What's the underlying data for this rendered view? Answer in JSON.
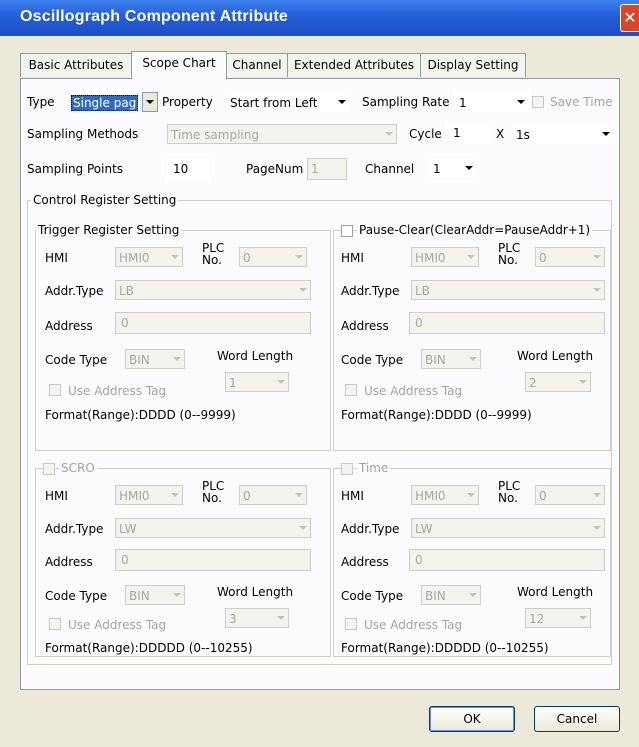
{
  "window": {
    "title": "Oscillograph Component Attribute",
    "close_glyph": "✕"
  },
  "tabs": [
    "Basic Attributes",
    "Scope Chart",
    "Channel",
    "Extended Attributes",
    "Display Setting"
  ],
  "scope": {
    "type_label": "Type",
    "type_value": "Single pag",
    "property_label": "Property",
    "property_value": "Start from Left",
    "sampling_rate_label": "Sampling Rate",
    "sampling_rate_value": "1",
    "save_time_label": "Save Time",
    "sampling_methods_label": "Sampling Methods",
    "sampling_methods_value": "Time sampling",
    "cycle_label": "Cycle",
    "cycle_value": "1",
    "x_label": "X",
    "cycle_unit": "1s",
    "sampling_points_label": "Sampling Points",
    "sampling_points_value": "10",
    "pagenum_label": "PageNum",
    "pagenum_value": "1",
    "channel_label": "Channel",
    "channel_value": "1"
  },
  "control": {
    "title": "Control Register Setting",
    "trigger": {
      "title": "Trigger Register Setting",
      "hmi_label": "HMI",
      "hmi_value": "HMI0",
      "plc_label1": "PLC",
      "plc_label2": "No.",
      "plc_value": "0",
      "addr_type_label": "Addr.Type",
      "addr_type_value": "LB",
      "address_label": "Address",
      "address_value": "0",
      "code_type_label": "Code Type",
      "code_type_value": "BIN",
      "word_length_label": "Word Length",
      "word_length_value": "1",
      "use_tag_label": "Use Address Tag",
      "format": "Format(Range):DDDD (0--9999)"
    },
    "pause": {
      "title": "Pause-Clear(ClearAddr=PauseAddr+1)",
      "hmi_label": "HMI",
      "hmi_value": "HMI0",
      "plc_label1": "PLC",
      "plc_label2": "No.",
      "plc_value": "0",
      "addr_type_label": "Addr.Type",
      "addr_type_value": "LB",
      "address_label": "Address",
      "address_value": "0",
      "code_type_label": "Code Type",
      "code_type_value": "BIN",
      "word_length_label": "Word Length",
      "word_length_value": "2",
      "use_tag_label": "Use Address Tag",
      "format": "Format(Range):DDDD (0--9999)"
    },
    "scro": {
      "title": "SCRO",
      "hmi_label": "HMI",
      "hmi_value": "HMI0",
      "plc_label1": "PLC",
      "plc_label2": "No.",
      "plc_value": "0",
      "addr_type_label": "Addr.Type",
      "addr_type_value": "LW",
      "address_label": "Address",
      "address_value": "0",
      "code_type_label": "Code Type",
      "code_type_value": "BIN",
      "word_length_label": "Word Length",
      "word_length_value": "3",
      "use_tag_label": "Use Address Tag",
      "format": "Format(Range):DDDDD (0--10255)"
    },
    "time": {
      "title": "Time",
      "hmi_label": "HMI",
      "hmi_value": "HMI0",
      "plc_label1": "PLC",
      "plc_label2": "No.",
      "plc_value": "0",
      "addr_type_label": "Addr.Type",
      "addr_type_value": "LW",
      "address_label": "Address",
      "address_value": "0",
      "code_type_label": "Code Type",
      "code_type_value": "BIN",
      "word_length_label": "Word Length",
      "word_length_value": "12",
      "use_tag_label": "Use Address Tag",
      "format": "Format(Range):DDDDD (0--10255)"
    }
  },
  "buttons": {
    "ok": "OK",
    "cancel": "Cancel"
  },
  "colors": {
    "titlebar": "#2660d8",
    "dialog_bg": "#ece9d8",
    "selection": "#316ac5"
  }
}
